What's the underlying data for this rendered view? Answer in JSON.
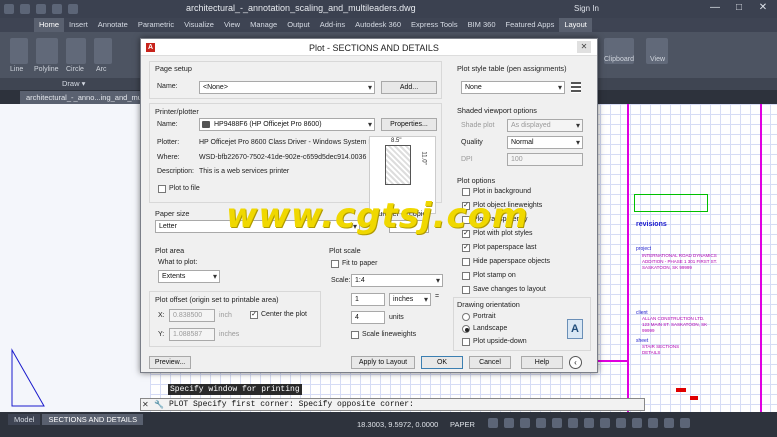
{
  "window": {
    "title": "architectural_-_annotation_scaling_and_multileaders.dwg",
    "sign_in": "Sign In",
    "min": "—",
    "max": "□",
    "close": "✕"
  },
  "ribbon": {
    "tabs": [
      "Home",
      "Insert",
      "Annotate",
      "Parametric",
      "Visualize",
      "View",
      "Manage",
      "Output",
      "Add-ins",
      "Autodesk 360",
      "Express Tools",
      "BIM 360",
      "Featured Apps",
      "Layout"
    ],
    "tools": [
      "Line",
      "Polyline",
      "Circle",
      "Arc"
    ],
    "panel_draw": "Draw ▾",
    "clipboard": "Clipboard",
    "view": "View"
  },
  "doc_tab": "architectural_-_anno...ing_and_mult...",
  "dialog": {
    "title": "Plot - SECTIONS AND DETAILS",
    "page_setup": {
      "label": "Page setup",
      "name_label": "Name:",
      "name_value": "<None>",
      "add_button": "Add..."
    },
    "printer": {
      "label": "Printer/plotter",
      "name_label": "Name:",
      "name_value": "HP9488F6 (HP Officejet Pro 8600)",
      "properties_button": "Properties...",
      "plotter_label": "Plotter:",
      "plotter_value": "HP Officejet Pro 8600 Class Driver - Windows System Dr...",
      "where_label": "Where:",
      "where_value": "WSD-bfb22670-7502-41de-902e-c659d5dec914.0036",
      "description_label": "Description:",
      "description_value": "This is a web services printer",
      "plot_to_file": "Plot to file",
      "paper_width": "8.5\"",
      "paper_height": "11.0\""
    },
    "paper_size": {
      "label": "Paper size",
      "value": "Letter"
    },
    "copies": {
      "label": "Number of copies",
      "value": "1"
    },
    "plot_area": {
      "label": "Plot area",
      "what_label": "What to plot:",
      "value": "Extents"
    },
    "plot_offset": {
      "label": "Plot offset (origin set to printable area)",
      "x_label": "X:",
      "x_value": "0.838500",
      "x_unit": "inch",
      "y_label": "Y:",
      "y_value": "1.088587",
      "y_unit": "inches",
      "center": "Center the plot"
    },
    "plot_scale": {
      "label": "Plot scale",
      "fit": "Fit to paper",
      "scale_label": "Scale:",
      "scale_value": "1:4",
      "v1": "1",
      "u1": "inches",
      "eq": "=",
      "v2": "4",
      "u2": "units",
      "lineweights": "Scale lineweights"
    },
    "style_table": {
      "label": "Plot style table (pen assignments)",
      "value": "None"
    },
    "shaded": {
      "label": "Shaded viewport options",
      "shade_label": "Shade plot",
      "shade_value": "As displayed",
      "quality_label": "Quality",
      "quality_value": "Normal",
      "dpi_label": "DPI",
      "dpi_value": "100"
    },
    "plot_options": {
      "label": "Plot options",
      "items": [
        {
          "text": "Plot in background",
          "checked": false
        },
        {
          "text": "Plot object lineweights",
          "checked": true
        },
        {
          "text": "Plot transparency",
          "checked": false
        },
        {
          "text": "Plot with plot styles",
          "checked": true
        },
        {
          "text": "Plot paperspace last",
          "checked": true
        },
        {
          "text": "Hide paperspace objects",
          "checked": false
        },
        {
          "text": "Plot stamp on",
          "checked": false
        },
        {
          "text": "Save changes to layout",
          "checked": false
        }
      ]
    },
    "orientation": {
      "label": "Drawing orientation",
      "portrait": "Portrait",
      "landscape": "Landscape",
      "upside": "Plot upside-down"
    },
    "buttons": {
      "preview": "Preview...",
      "apply": "Apply to Layout",
      "ok": "OK",
      "cancel": "Cancel",
      "help": "Help"
    }
  },
  "watermark": "www.cgtsj.com",
  "drawing": {
    "revisions": "revisions",
    "project_label": "project",
    "project": "INTERNATIONAL ROAD DYNAMICS ADDITION - PHASE 1 301 FIRST ST. SASKATOON, SK 99999",
    "client_label": "client",
    "client": "ALLAN CONSTRUCTION LTD. 123 MAIN ST. SASKATOON, SK 99999",
    "sheet_label": "sheet",
    "sheet": "STAIR SECTIONS DETAILS"
  },
  "command": {
    "hint": "Specify window for printing",
    "line": "PLOT Specify first corner: Specify opposite corner:"
  },
  "layout_tabs": [
    "Model",
    "SECTIONS AND DETAILS"
  ],
  "status": {
    "coords": "18.3003, 9.5972, 0.0000",
    "paper": "PAPER"
  }
}
